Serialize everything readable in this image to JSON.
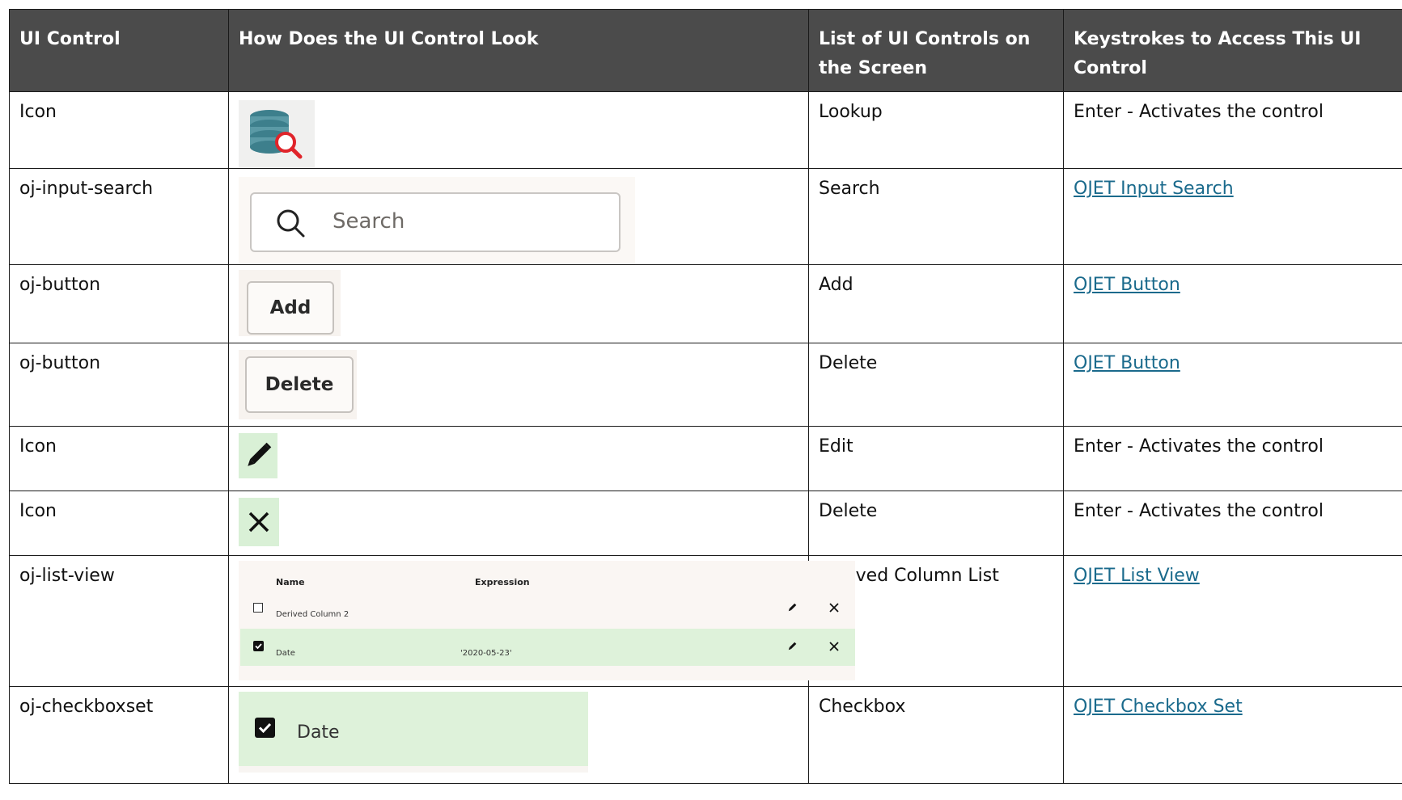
{
  "table": {
    "headers": [
      "UI Control",
      "How Does the UI Control Look",
      "List of UI Controls on the Screen",
      "Keystrokes to Access This UI Control"
    ],
    "rows": [
      {
        "control": "Icon",
        "list_item": "Lookup",
        "keystroke": "Enter - Activates the control",
        "link": false
      },
      {
        "control": "oj-input-search",
        "list_item": "Search",
        "keystroke": "OJET Input Search",
        "link": true
      },
      {
        "control": "oj-button",
        "list_item": "Add",
        "keystroke": "OJET Button",
        "link": true
      },
      {
        "control": "oj-button",
        "list_item": "Delete",
        "keystroke": "OJET Button",
        "link": true
      },
      {
        "control": "Icon",
        "list_item": "Edit",
        "keystroke": "Enter - Activates the control",
        "link": false
      },
      {
        "control": "Icon",
        "list_item": "Delete",
        "keystroke": "Enter - Activates the control",
        "link": false
      },
      {
        "control": "oj-list-view",
        "list_item": "Derived Column List",
        "keystroke": "OJET List View",
        "link": true
      },
      {
        "control": "oj-checkboxset",
        "list_item": "Checkbox",
        "keystroke": "OJET Checkbox Set",
        "link": true
      }
    ]
  },
  "previews": {
    "search_placeholder": "Search",
    "add_label": "Add",
    "delete_label": "Delete",
    "list_view": {
      "col_name": "Name",
      "col_expression": "Expression",
      "rows": [
        {
          "name": "Derived Column 2",
          "expression": "",
          "checked": false
        },
        {
          "name": "Date",
          "expression": "'2020-05-23'",
          "checked": true
        }
      ]
    },
    "checkbox_label": "Date",
    "icons": {
      "lookup": "database-search-icon",
      "edit": "pencil-icon",
      "delete": "close-icon",
      "search": "search-icon",
      "checkbox": "checkbox-icon"
    }
  }
}
